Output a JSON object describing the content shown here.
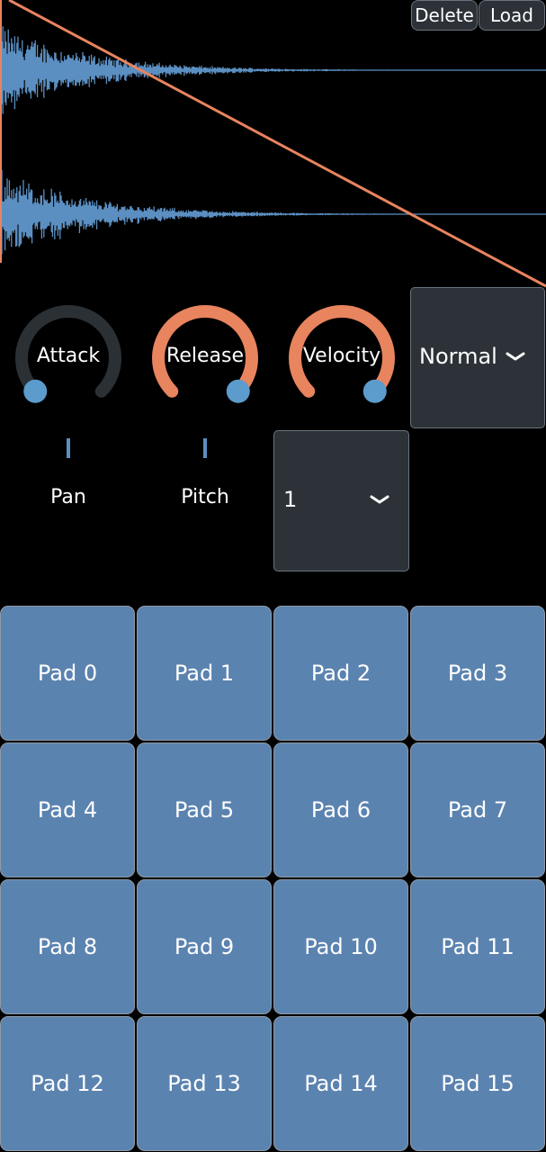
{
  "top_buttons": {
    "delete_label": "Delete",
    "load_label": "Load"
  },
  "knobs": [
    {
      "label": "Attack",
      "value": 0.0,
      "arc_color": "#2b3034",
      "handle_color": "#5b9ccc"
    },
    {
      "label": "Release",
      "value": 1.0,
      "arc_color": "#e8845e",
      "handle_color": "#5b9ccc"
    },
    {
      "label": "Velocity",
      "value": 1.0,
      "arc_color": "#e8845e",
      "handle_color": "#5b9ccc"
    }
  ],
  "sliders": [
    {
      "label": "Pan"
    },
    {
      "label": "Pitch"
    }
  ],
  "mode_dropdown": {
    "value": "Normal"
  },
  "channel_dropdown": {
    "value": "1"
  },
  "pads": [
    "Pad 0",
    "Pad 1",
    "Pad 2",
    "Pad 3",
    "Pad 4",
    "Pad 5",
    "Pad 6",
    "Pad 7",
    "Pad 8",
    "Pad 9",
    "Pad 10",
    "Pad 11",
    "Pad 12",
    "Pad 13",
    "Pad 14",
    "Pad 15"
  ],
  "colors": {
    "background": "#000000",
    "waveform": "#5b8fc2",
    "envelope_line": "#e8845e",
    "pad": "#5b83b0",
    "control_bg": "#2c3238"
  }
}
